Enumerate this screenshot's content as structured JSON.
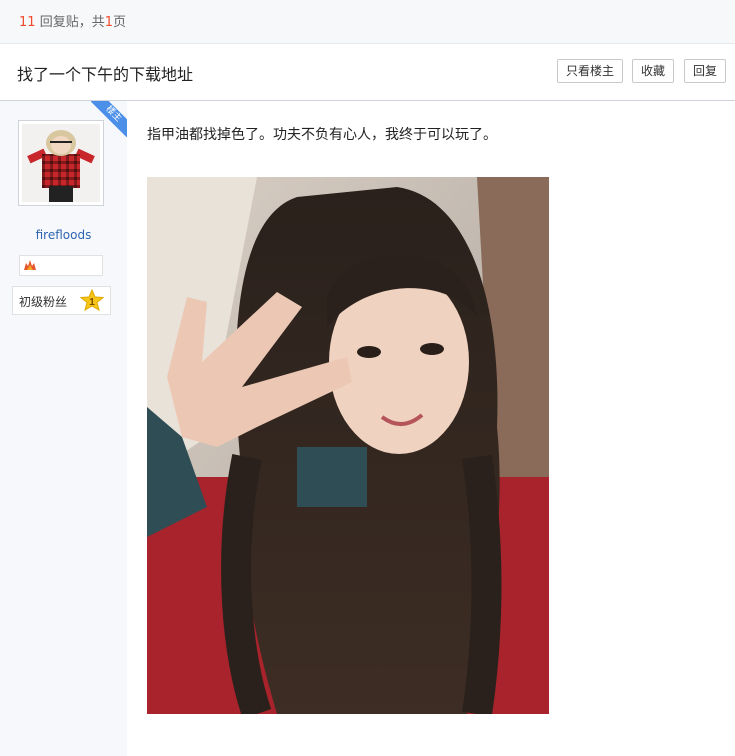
{
  "top_bar": {
    "reply_count": "11",
    "reply_text": "回复贴，共",
    "page_count": "1",
    "page_text": "页"
  },
  "thread": {
    "title": "找了一个下午的下载地址",
    "buttons": {
      "only_op": "只看楼主",
      "favorite": "收藏",
      "reply": "回复"
    }
  },
  "author": {
    "op_badge": "楼主",
    "username": "firefloods",
    "level_title": "初级粉丝",
    "level_number": "1",
    "avatar": "toddler-in-red-plaid-shirt"
  },
  "post": {
    "text": "指甲油都找掉色了。功夫不负有心人，我终于可以玩了。",
    "image": "girl-long-hair-peace-sign-selfie"
  },
  "colors": {
    "accent_blue": "#4c8fe8",
    "link_blue": "#2d64b3",
    "highlight_red": "#f04a2e"
  }
}
